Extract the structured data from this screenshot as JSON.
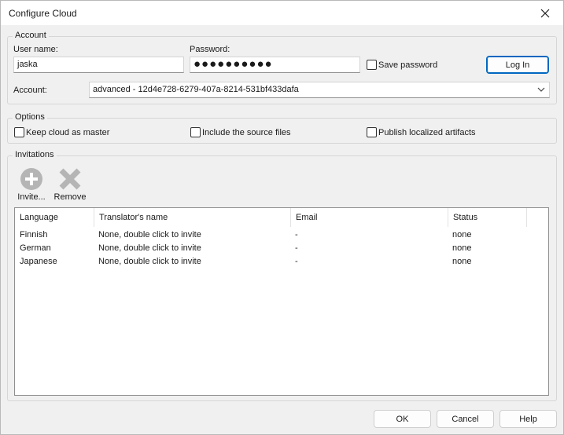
{
  "window": {
    "title": "Configure Cloud"
  },
  "account_group": {
    "legend": "Account",
    "username_label": "User name:",
    "username_value": "jaska",
    "password_label": "Password:",
    "password_value": "●●●●●●●●●●",
    "save_password_label": "Save password",
    "save_password_checked": false,
    "login_button": "Log In",
    "account_label": "Account:",
    "account_value": "advanced - 12d4e728-6279-407a-8214-531bf433dafa"
  },
  "options_group": {
    "legend": "Options",
    "keep_master_label": "Keep cloud as master",
    "include_source_label": "Include the source files",
    "publish_artifacts_label": "Publish localized artifacts"
  },
  "invitations_group": {
    "legend": "Invitations",
    "invite_label": "Invite...",
    "remove_label": "Remove",
    "columns": [
      "Language",
      "Translator's name",
      "Email",
      "Status"
    ],
    "rows": [
      {
        "language": "Finnish",
        "translator": "None, double click to invite",
        "email": "-",
        "status": "none"
      },
      {
        "language": "German",
        "translator": "None, double click to invite",
        "email": "-",
        "status": "none"
      },
      {
        "language": "Japanese",
        "translator": "None, double click to invite",
        "email": "-",
        "status": "none"
      }
    ]
  },
  "footer": {
    "ok": "OK",
    "cancel": "Cancel",
    "help": "Help"
  },
  "colors": {
    "accent": "#0067c0",
    "icon_gray": "#b5b5b5"
  }
}
